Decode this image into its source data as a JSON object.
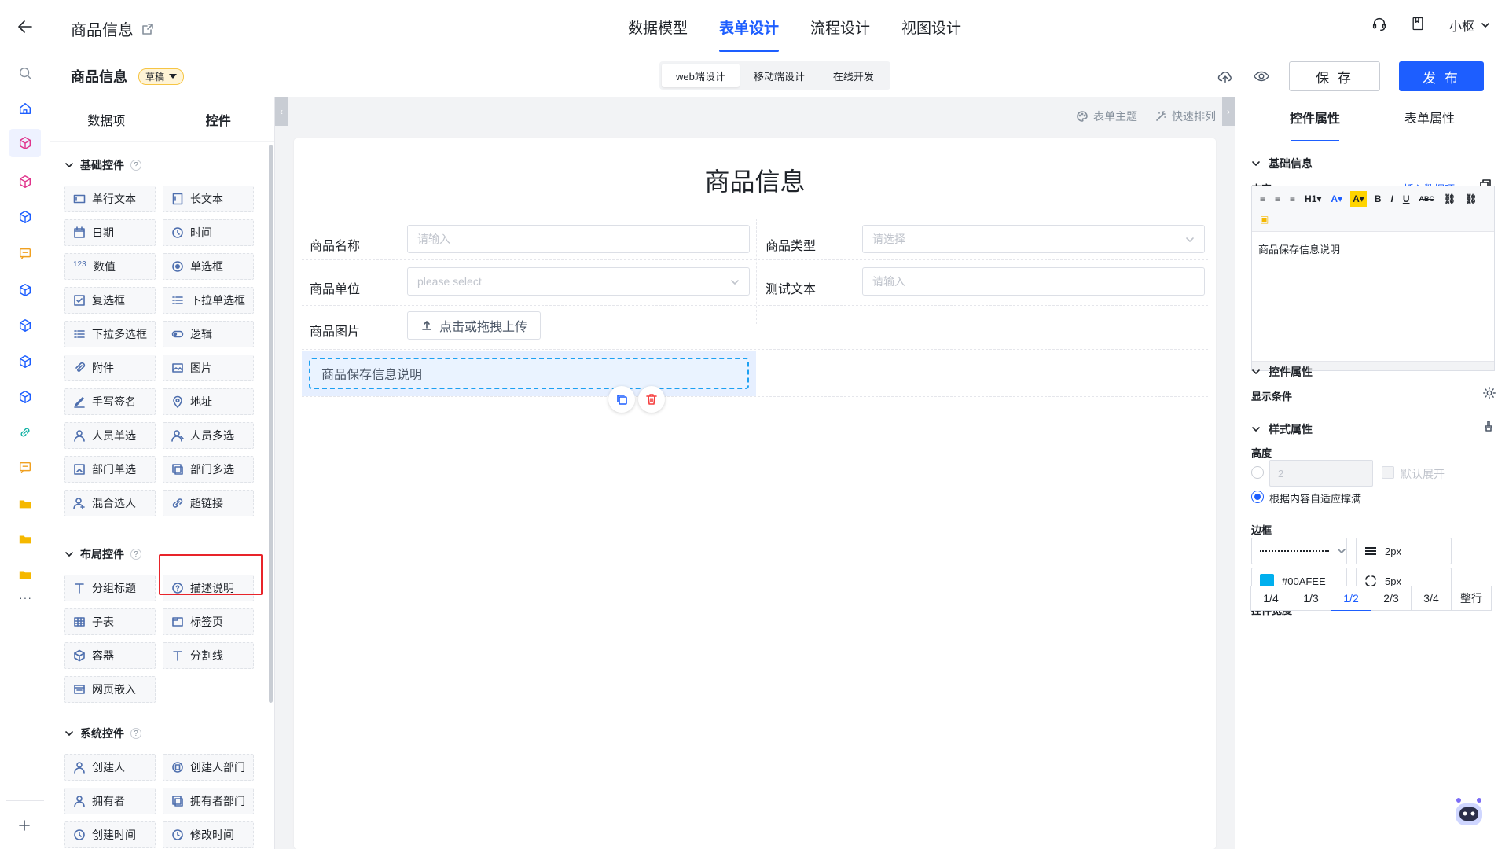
{
  "header": {
    "app_title": "商品信息",
    "tabs": [
      {
        "label": "数据模型"
      },
      {
        "label": "表单设计"
      },
      {
        "label": "流程设计"
      },
      {
        "label": "视图设计"
      }
    ],
    "user_name": "小枢"
  },
  "subbar": {
    "form_name": "商品信息",
    "status_badge": "草稿",
    "modes": [
      "web端设计",
      "移动端设计",
      "在线开发"
    ],
    "save_label": "保 存",
    "publish_label": "发 布"
  },
  "left_panel": {
    "tabs": [
      "数据项",
      "控件"
    ],
    "groups": [
      {
        "title": "基础控件",
        "items": [
          "单行文本",
          "长文本",
          "日期",
          "时间",
          "数值",
          "单选框",
          "复选框",
          "下拉单选框",
          "下拉多选框",
          "逻辑",
          "附件",
          "图片",
          "手写签名",
          "地址",
          "人员单选",
          "人员多选",
          "部门单选",
          "部门多选",
          "混合选人",
          "超链接"
        ]
      },
      {
        "title": "布局控件",
        "items": [
          "分组标题",
          "描述说明",
          "子表",
          "标签页",
          "容器",
          "分割线",
          "网页嵌入"
        ]
      },
      {
        "title": "系统控件",
        "items": [
          "创建人",
          "创建人部门",
          "拥有者",
          "拥有者部门",
          "创建时间",
          "修改时间"
        ]
      }
    ]
  },
  "canvas": {
    "tools": [
      "表单主题",
      "快速排列"
    ],
    "form_title": "商品信息",
    "fields": [
      {
        "label": "商品名称",
        "placeholder": "请输入"
      },
      {
        "label": "商品类型",
        "placeholder": "请选择"
      },
      {
        "label": "商品单位",
        "placeholder": "please select"
      },
      {
        "label": "测试文本",
        "placeholder": "请输入"
      },
      {
        "label": "商品图片",
        "button": "点击或拖拽上传"
      }
    ],
    "description_block": "商品保存信息说明"
  },
  "right_panel": {
    "tabs": [
      "控件属性",
      "表单属性"
    ],
    "basic_section": "基础信息",
    "content_label": "内容",
    "insert_link": "插入数据项",
    "editor_text": "商品保存信息说明",
    "control_section": "控件属性",
    "display_condition": "显示条件",
    "style_section": "样式属性",
    "height_label": "高度",
    "height_value": "2",
    "default_expand": "默认展开",
    "auto_fit": "根据内容自适应撑满",
    "border_label": "边框",
    "border_width": "2px",
    "border_color": "#00AFEE",
    "border_radius": "5px",
    "width_label": "控件宽度",
    "width_options": [
      "1/4",
      "1/3",
      "1/2",
      "2/3",
      "3/4",
      "整行"
    ],
    "selected_width": "1/2"
  },
  "colors": {
    "accent": "#1d5eff",
    "highlight_border": "#e8242a",
    "border_swatch": "#00afee"
  }
}
